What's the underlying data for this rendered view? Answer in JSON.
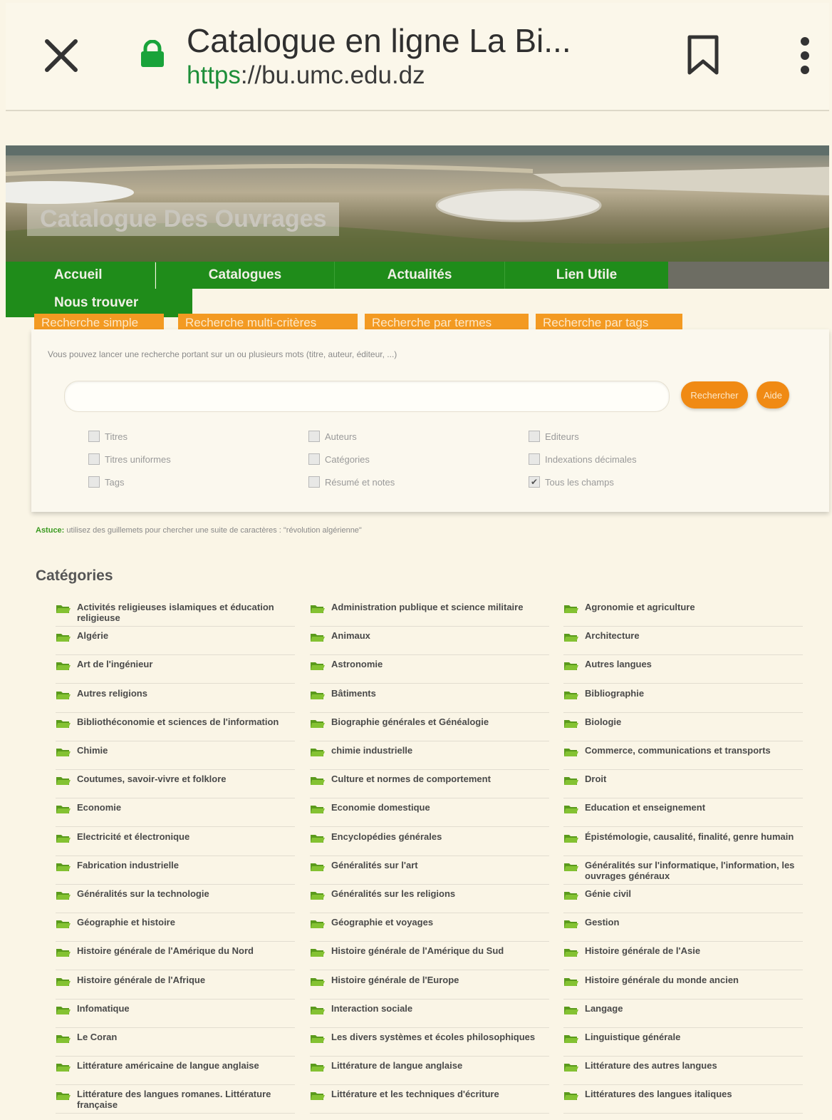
{
  "browser": {
    "title": "Catalogue en ligne La Bi...",
    "url_scheme": "https",
    "url_rest": "://bu.umc.edu.dz",
    "accent": "#1e8f3a"
  },
  "banner": {
    "title": "Catalogue Des Ouvrages"
  },
  "nav": [
    "Accueil",
    "Catalogues",
    "Actualités",
    "Lien Utile",
    "Nous trouver"
  ],
  "search_tabs": [
    "Recherche simple",
    "Recherche multi-critères",
    "Recherche par termes",
    "Recherche par tags"
  ],
  "search": {
    "hint": "Vous pouvez lancer une recherche portant sur un ou plusieurs mots (titre, auteur, éditeur, ...)",
    "input_value": "",
    "search_button": "Rechercher",
    "help_button": "Aide",
    "options": [
      {
        "label": "Titres",
        "checked": false
      },
      {
        "label": "Auteurs",
        "checked": false
      },
      {
        "label": "Editeurs",
        "checked": false
      },
      {
        "label": "Titres uniformes",
        "checked": false
      },
      {
        "label": "Catégories",
        "checked": false
      },
      {
        "label": "Indexations décimales",
        "checked": false
      },
      {
        "label": "Tags",
        "checked": false
      },
      {
        "label": "Résumé et notes",
        "checked": false
      },
      {
        "label": "Tous les champs",
        "checked": true
      }
    ]
  },
  "tip": {
    "prefix": "Astuce:",
    "text": "utilisez des guillemets pour chercher une suite de caractères : \"révolution algérienne\""
  },
  "categories_heading": "Catégories",
  "categories": [
    "Activités religieuses islamiques et éducation religieuse",
    "Administration publique et science militaire",
    "Agronomie et agriculture",
    "Algérie",
    "Animaux",
    "Architecture",
    "Art de l'ingénieur",
    "Astronomie",
    "Autres langues",
    "Autres religions",
    "Bâtiments",
    "Bibliographie",
    "Bibliothéconomie et sciences de l'information",
    "Biographie générales et Généalogie",
    "Biologie",
    "Chimie",
    "chimie industrielle",
    "Commerce, communications et transports",
    "Coutumes, savoir-vivre et folklore",
    "Culture et normes de comportement",
    "Droit",
    "Economie",
    "Economie domestique",
    "Education et enseignement",
    "Electricité et électronique",
    "Encyclopédies générales",
    "Épistémologie, causalité, finalité, genre humain",
    "Fabrication industrielle",
    "Généralités sur l'art",
    "Généralités sur l'informatique, l'information, les ouvrages généraux",
    "Généralités sur la technologie",
    "Généralités sur les religions",
    "Génie civil",
    "Géographie et histoire",
    "Géographie et voyages",
    "Gestion",
    "Histoire générale de l'Amérique du Nord",
    "Histoire générale de l'Amérique du Sud",
    "Histoire générale de l'Asie",
    "Histoire générale de l'Afrique",
    "Histoire générale de l'Europe",
    "Histoire générale du monde ancien",
    "Infomatique",
    "Interaction sociale",
    "Langage",
    "Le Coran",
    "Les divers systèmes et écoles philosophiques",
    "Linguistique générale",
    "Littérature américaine de langue anglaise",
    "Littérature de langue anglaise",
    "Littérature des autres langues",
    "Littérature des langues romanes. Littérature française",
    "Littérature et les techniques d'écriture",
    "Littératures des langues italiques"
  ]
}
